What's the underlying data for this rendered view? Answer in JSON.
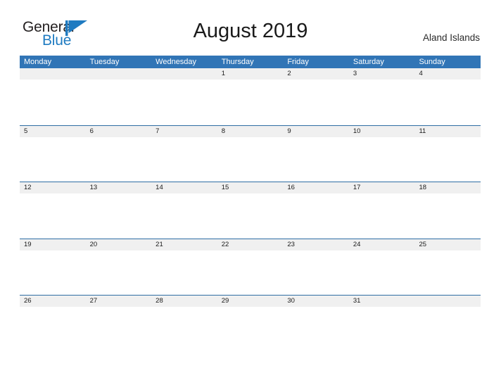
{
  "brand": {
    "name_part1": "General",
    "name_part2": "Blue",
    "flag_icon": "triangle-flag-icon",
    "accent_color": "#1f7bc1"
  },
  "header": {
    "title": "August 2019",
    "location": "Aland Islands"
  },
  "theme": {
    "header_blue": "#3175b6",
    "row_border_blue": "#2e6da4",
    "date_band_gray": "#f0f0f0",
    "text_dark": "#1a1a1a"
  },
  "calendar": {
    "month": "August",
    "year": "2019",
    "weekday_headers": [
      "Monday",
      "Tuesday",
      "Wednesday",
      "Thursday",
      "Friday",
      "Saturday",
      "Sunday"
    ],
    "weeks": [
      {
        "days": [
          "",
          "",
          "",
          "1",
          "2",
          "3",
          "4"
        ]
      },
      {
        "days": [
          "5",
          "6",
          "7",
          "8",
          "9",
          "10",
          "11"
        ]
      },
      {
        "days": [
          "12",
          "13",
          "14",
          "15",
          "16",
          "17",
          "18"
        ]
      },
      {
        "days": [
          "19",
          "20",
          "21",
          "22",
          "23",
          "24",
          "25"
        ]
      },
      {
        "days": [
          "26",
          "27",
          "28",
          "29",
          "30",
          "31",
          ""
        ]
      }
    ]
  }
}
